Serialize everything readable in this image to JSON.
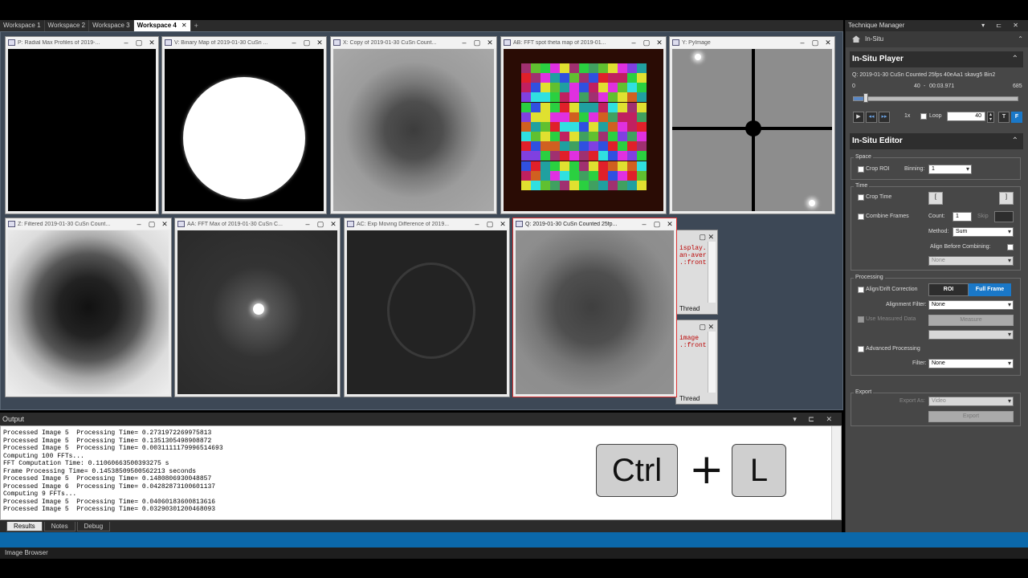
{
  "workspace_tabs": [
    "Workspace 1",
    "Workspace 2",
    "Workspace 3",
    "Workspace 4"
  ],
  "active_workspace": "Workspace 4",
  "windows": {
    "p": "P: Radial Max Profiles of 2019-...",
    "v": "V: Binary Map of 2019-01-30 CuSn ...",
    "x": "X: Copy of 2019-01-30 CuSn Count...",
    "ab": "AB: FFT spot theta map of 2019-01...",
    "y": "Y: PyImage",
    "z": "Z: Filtered 2019-01-30 CuSn Count...",
    "aa": "AA: FFT Max of 2019-01-30 CuSn C...",
    "ac": "AC: Exp Moving Difference of 2019...",
    "q": "Q: 2019-01-30 CuSn Counted 25fp..."
  },
  "script_windows": {
    "top_lines": [
      "isplay.",
      "an-aver",
      "",
      "",
      ".:front"
    ],
    "bottom_lines": [
      "image",
      "",
      "",
      "",
      ".:front"
    ],
    "thread_label": "Thread"
  },
  "output": {
    "title": "Output",
    "lines": [
      "Processed Image 5  Processing Time= 0.2731972269975813",
      "Processed Image 5  Processing Time= 0.1351305498908872",
      "Processed Image 5  Processing Time= 0.0031111179996514693",
      "Computing 100 FFTs...",
      "FFT Computation Time: 0.11060663500393275 s",
      "Frame Processing Time= 0.14538509500562213 seconds",
      "Processed Image 5  Processing Time= 0.1480806930048857",
      "Processed Image 6  Processing Time= 0.04282873100601137",
      "Computing 9 FFTs...",
      "Processed Image 5  Processing Time= 0.04060183600813616",
      "Processed Image 5  Processing Time= 0.03290301200468093"
    ],
    "tabs": [
      "Results",
      "Notes",
      "Debug"
    ],
    "active_tab": "Results"
  },
  "status_bar": "Image Browser",
  "keys": {
    "ctrl": "Ctrl",
    "plus": "+",
    "l": "L"
  },
  "technique_manager": {
    "title": "Technique Manager",
    "technique": "In-Situ",
    "player": {
      "header": "In-Situ Player",
      "dataset": "Q: 2019-01-30 CuSn Counted 25fps 40eAa1 skavg5 Bin2",
      "range_start": "0",
      "current_frame": "40",
      "time": "00:03.971",
      "range_end": "685",
      "position_fraction": 0.058,
      "speed": "1x",
      "loop_label": "Loop",
      "frame_field": "40",
      "t_button": "T",
      "f_button": "F"
    },
    "editor": {
      "header": "In-Situ Editor",
      "space_label": "Space",
      "crop_roi": "Crop ROI",
      "binning_label": "Binning:",
      "binning_value": "1",
      "time_label": "Time",
      "crop_time": "Crop Time",
      "bracket_open": "[",
      "bracket_close": "]",
      "combine_frames": "Combine Frames",
      "count_label": "Count:",
      "count_value": "1",
      "skip_label": "Skip",
      "method_label": "Method:",
      "method_value": "Sum",
      "align_before": "Align Before Combining:",
      "align_before_value": "None",
      "processing_label": "Processing",
      "drift_correction": "Align/Drift Correction",
      "roi_button": "ROI",
      "full_frame_button": "Full Frame",
      "alignment_filter_label": "Alignment Filter:",
      "alignment_filter_value": "None",
      "use_measured": "Use Measured Data",
      "measure_button": "Measure",
      "advanced_processing": "Advanced Processing",
      "filter_label": "Filter:",
      "filter_value": "None",
      "export_label": "Export",
      "export_as_label": "Export As:",
      "export_as_value": "Video",
      "export_button": "Export"
    }
  },
  "colors": {
    "accent": "#1a78c8",
    "status_blue": "#0b68aa",
    "workspace_bg": "#3d4856",
    "selected_border": "#dd3333"
  }
}
